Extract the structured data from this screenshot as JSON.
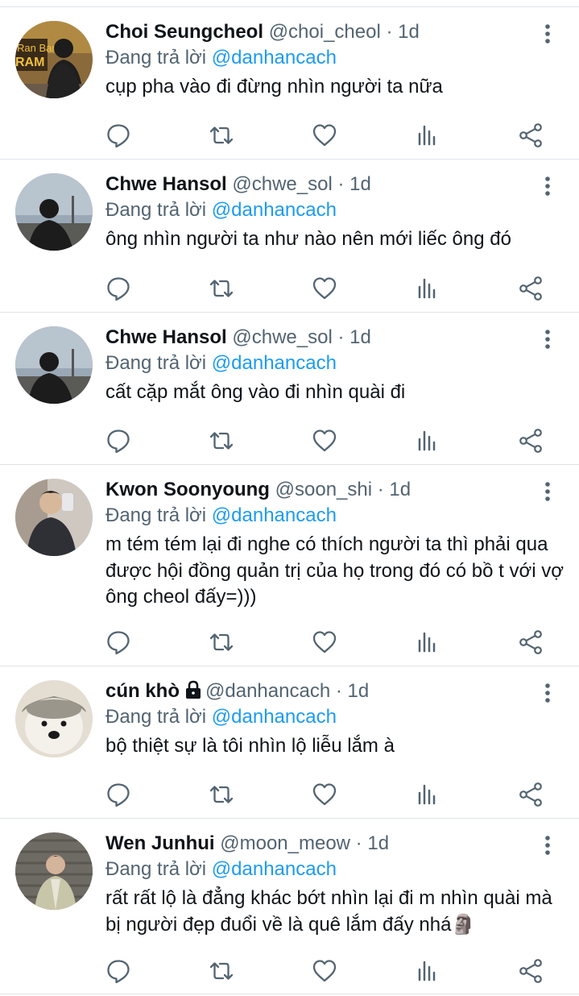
{
  "reply_prefix": "Đang trả lời",
  "colors": {
    "accent": "#1d9bf0",
    "secondary_text": "#536471",
    "primary_text": "#0f1419",
    "divider": "#dfe3e6"
  },
  "tweets": [
    {
      "name": "Choi Seungcheol",
      "handle": "@choi_cheol",
      "dot": "·",
      "time": "1d",
      "reply_to": "@danhancach",
      "text": "cụp pha vào đi đừng nhìn người ta nữa",
      "avatar": "avatar-photo-seungcheol"
    },
    {
      "name": "Chwe Hansol",
      "handle": "@chwe_sol",
      "dot": "·",
      "time": "1d",
      "reply_to": "@danhancach",
      "text": "ông nhìn người ta như nào nên mới liếc ông đó",
      "avatar": "avatar-photo-hansol"
    },
    {
      "name": "Chwe Hansol",
      "handle": "@chwe_sol",
      "dot": "·",
      "time": "1d",
      "reply_to": "@danhancach",
      "text": "cất cặp mắt ông vào đi nhìn quài đi",
      "avatar": "avatar-photo-hansol"
    },
    {
      "name": "Kwon Soonyoung",
      "handle": "@soon_shi",
      "dot": "·",
      "time": "1d",
      "reply_to": "@danhancach",
      "text": "m tém tém lại đi nghe có thích người ta thì phải qua được hội đồng quản trị của họ trong đó có bồ t với vợ ông cheol đấy=)))",
      "avatar": "avatar-photo-soonyoung"
    },
    {
      "name": "cún khò",
      "handle": "@danhancach",
      "dot": "·",
      "time": "1d",
      "reply_to": "@danhancach",
      "text": "bộ thiệt sự là tôi nhìn lộ liễu lắm à",
      "avatar": "avatar-photo-dog",
      "locked": true
    },
    {
      "name": "Wen Junhui",
      "handle": "@moon_meow",
      "dot": "·",
      "time": "1d",
      "reply_to": "@danhancach",
      "text": "rất rất lộ là đẳng khác bớt nhìn lại đi m nhìn quài mà bị người đẹp đuổi về là quê lắm đấy nhá🗿",
      "avatar": "avatar-photo-junhui"
    }
  ]
}
